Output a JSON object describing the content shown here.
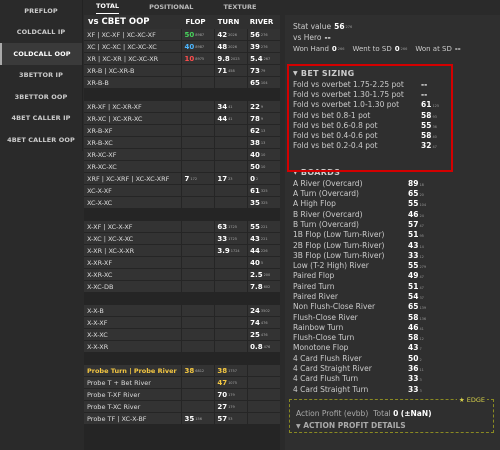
{
  "sidebar": {
    "items": [
      "PREFLOP",
      "COLDCALL IP",
      "COLDCALL OOP",
      "3BETTOR IP",
      "3BETTOR OOP",
      "4BET CALLER IP",
      "4BET CALLER OOP"
    ]
  },
  "tabs": [
    "TOTAL",
    "POSITIONAL",
    "TEXTURE"
  ],
  "table": {
    "title": "vs CBET OOP",
    "col_flop": "FLOP",
    "col_turn": "TURN",
    "col_river": "RIVER",
    "rows": [
      {
        "name": "XF | XC-XF | XC-XC-XF",
        "flop": "50",
        "flop_sub": "8987",
        "flop_color": "green",
        "turn": "42",
        "turn_sub": "2026",
        "river": "56",
        "river_sub": "276"
      },
      {
        "name": "XC | XC-XC | XC-XC-XC",
        "flop": "40",
        "flop_sub": "8987",
        "flop_color": "blue",
        "turn": "48",
        "turn_sub": "2026",
        "river": "39",
        "river_sub": "276"
      },
      {
        "name": "XR | XC-XR | XC-XC-XR",
        "flop": "10",
        "flop_sub": "8975",
        "flop_color": "red",
        "turn": "9.8",
        "turn_sub": "2023",
        "river": "5.4",
        "river_sub": "267"
      },
      {
        "name": "XR-B | XC-XR-B",
        "flop": "",
        "turn": "71",
        "turn_sub": "458",
        "river": "73",
        "river_sub": "79"
      },
      {
        "name": "XR-B-B",
        "flop": "",
        "turn": "",
        "river": "65",
        "river_sub": "104"
      },
      {
        "gap": true
      },
      {
        "name": "XR-XF | XC-XR-XF",
        "flop": "",
        "turn": "34",
        "turn_sub": "41",
        "river": "22",
        "river_sub": "9"
      },
      {
        "name": "XR-XC | XC-XR-XC",
        "flop": "",
        "turn": "44",
        "turn_sub": "41",
        "river": "78",
        "river_sub": "9"
      },
      {
        "name": "XR-B-XF",
        "flop": "",
        "turn": "",
        "river": "62",
        "river_sub": "13"
      },
      {
        "name": "XR-B-XC",
        "flop": "",
        "turn": "",
        "river": "38",
        "river_sub": "13"
      },
      {
        "name": "XR-XC-XF",
        "flop": "",
        "turn": "",
        "river": "40",
        "river_sub": "10"
      },
      {
        "name": "XR-XC-XC",
        "flop": "",
        "turn": "",
        "river": "50",
        "river_sub": "10"
      },
      {
        "name": "XRF | XC-XRF | XC-XC-XRF",
        "flop": "7",
        "flop_sub": "172",
        "turn": "17",
        "turn_sub": "23",
        "river": "0",
        "river_sub": "2"
      },
      {
        "name": "XC-X-XF",
        "flop": "",
        "turn": "",
        "river": "61",
        "river_sub": "325"
      },
      {
        "name": "XC-X-XC",
        "flop": "",
        "turn": "",
        "river": "35",
        "river_sub": "325"
      },
      {
        "gap": true
      },
      {
        "name": "X-XF | XC-X-XF",
        "flop": "",
        "turn": "63",
        "turn_sub": "1725",
        "river": "55",
        "river_sub": "221"
      },
      {
        "name": "X-XC | XC-X-XC",
        "flop": "",
        "turn": "33",
        "turn_sub": "1725",
        "river": "43",
        "river_sub": "221"
      },
      {
        "name": "X-XR | XC-X-XR",
        "flop": "",
        "turn": "3.9",
        "turn_sub": "1724",
        "river": "44",
        "river_sub": "226"
      },
      {
        "name": "X-XR-XF",
        "flop": "",
        "turn": "",
        "river": "40",
        "river_sub": "5"
      },
      {
        "name": "X-XR-XC",
        "flop": "",
        "turn": "",
        "river": "2.5",
        "river_sub": "200"
      },
      {
        "name": "X-XC-DB",
        "flop": "",
        "turn": "",
        "river": "7.8",
        "river_sub": "602"
      },
      {
        "gap": true
      },
      {
        "name": "X-X-B",
        "flop": "",
        "turn": "",
        "river": "24",
        "river_sub": "3502"
      },
      {
        "name": "X-X-XF",
        "flop": "",
        "turn": "",
        "river": "74",
        "river_sub": "476"
      },
      {
        "name": "X-X-XC",
        "flop": "",
        "turn": "",
        "river": "25",
        "river_sub": "476"
      },
      {
        "name": "X-X-XR",
        "flop": "",
        "turn": "",
        "river": "0.8",
        "river_sub": "476"
      },
      {
        "gap": true
      },
      {
        "name": "Probe Turn | Probe River",
        "probe": true,
        "flop": "38",
        "flop_sub": "6812",
        "flop_color": "gold",
        "turn": "38",
        "turn_sub": "1757",
        "turn_color": "gold"
      },
      {
        "name": "Probe T + Bet River",
        "flop": "",
        "turn": "47",
        "turn_sub": "1075",
        "turn_color": "gold",
        "river": ""
      },
      {
        "name": "Probe T-XF River",
        "flop": "",
        "turn": "70",
        "turn_sub": "179",
        "river": ""
      },
      {
        "name": "Probe T-XC River",
        "flop": "",
        "turn": "27",
        "turn_sub": "179",
        "river": ""
      },
      {
        "name": "Probe TF | XC-X-BF",
        "flop": "35",
        "flop_sub": "156",
        "turn": "57",
        "turn_sub": "53",
        "river": ""
      }
    ]
  },
  "stats": {
    "stat_value_label": "Stat value",
    "stat_value": "56",
    "stat_value_sub": "276",
    "vs_hero_label": "vs Hero",
    "vs_hero": "--",
    "won_hand_label": "Won Hand",
    "won_hand": "0",
    "won_hand_sub": "266",
    "went_sd_label": "Went to SD",
    "went_sd": "0",
    "went_sd_sub": "266",
    "won_sd_label": "Won at SD",
    "won_sd": "--"
  },
  "bet_sizing": {
    "title": "BET SIZING",
    "rows": [
      {
        "k": "Fold vs overbet 1.75-2.25 pot",
        "v": "--",
        "sub": ""
      },
      {
        "k": "Fold vs overbet 1.30-1.75 pot",
        "v": "--",
        "sub": ""
      },
      {
        "k": "Fold vs overbet 1.0-1.30 pot",
        "v": "61",
        "sub": "125"
      },
      {
        "k": "Fold vs bet 0.8-1 pot",
        "v": "58",
        "sub": "93"
      },
      {
        "k": "Fold vs bet 0.6-0.8 pot",
        "v": "55",
        "sub": "36"
      },
      {
        "k": "Fold vs bet 0.4-0.6 pot",
        "v": "58",
        "sub": "40"
      },
      {
        "k": "Fold vs bet 0.2-0.4 pot",
        "v": "32",
        "sub": "47"
      }
    ]
  },
  "boards": {
    "title": "BOARDS",
    "rows": [
      {
        "k": "A River (Overcard)",
        "v": "89",
        "sub": "18"
      },
      {
        "k": "A Turn (Overcard)",
        "v": "65",
        "sub": "20"
      },
      {
        "k": "A High Flop",
        "v": "55",
        "sub": "104"
      },
      {
        "k": "B River (Overcard)",
        "v": "46",
        "sub": "24"
      },
      {
        "k": "B Turn (Overcard)",
        "v": "57",
        "sub": "47"
      },
      {
        "k": "1B Flop (Low Turn-River)",
        "v": "51",
        "sub": "95"
      },
      {
        "k": "2B Flop (Low Turn-River)",
        "v": "43",
        "sub": "14"
      },
      {
        "k": "3B Flop (Low Turn-River)",
        "v": "33",
        "sub": "12"
      },
      {
        "k": "Low (T-2 High) River",
        "v": "55",
        "sub": "279"
      },
      {
        "k": "Paired Flop",
        "v": "49",
        "sub": "47"
      },
      {
        "k": "Paired Turn",
        "v": "51",
        "sub": "47"
      },
      {
        "k": "Paired River",
        "v": "54",
        "sub": "37"
      },
      {
        "k": "Non Flush-Close River",
        "v": "65",
        "sub": "139"
      },
      {
        "k": "Flush-Close River",
        "v": "58",
        "sub": "136"
      },
      {
        "k": "Rainbow Turn",
        "v": "46",
        "sub": "41"
      },
      {
        "k": "Flush-Close Turn",
        "v": "58",
        "sub": "12"
      },
      {
        "k": "Monotone Flop",
        "v": "43",
        "sub": "7"
      },
      {
        "k": "4 Card Flush River",
        "v": "50",
        "sub": "2"
      },
      {
        "k": "4 Card Straight River",
        "v": "36",
        "sub": "11"
      },
      {
        "k": "4 Card Flush Turn",
        "v": "33",
        "sub": "3"
      },
      {
        "k": "4 Card Straight Turn",
        "v": "33",
        "sub": "3"
      }
    ]
  },
  "edge": {
    "tag": "EDGE",
    "ap_label": "Action Profit (evbb)",
    "total_label": "Total",
    "total_value": "0",
    "total_extra": "(±NaN)",
    "details": "ACTION PROFIT DETAILS"
  },
  "colors": {
    "accent": "#d40000",
    "green": "#47d25b",
    "blue": "#4db7ff",
    "red": "#ff4e4e",
    "gold": "#f5c842"
  }
}
